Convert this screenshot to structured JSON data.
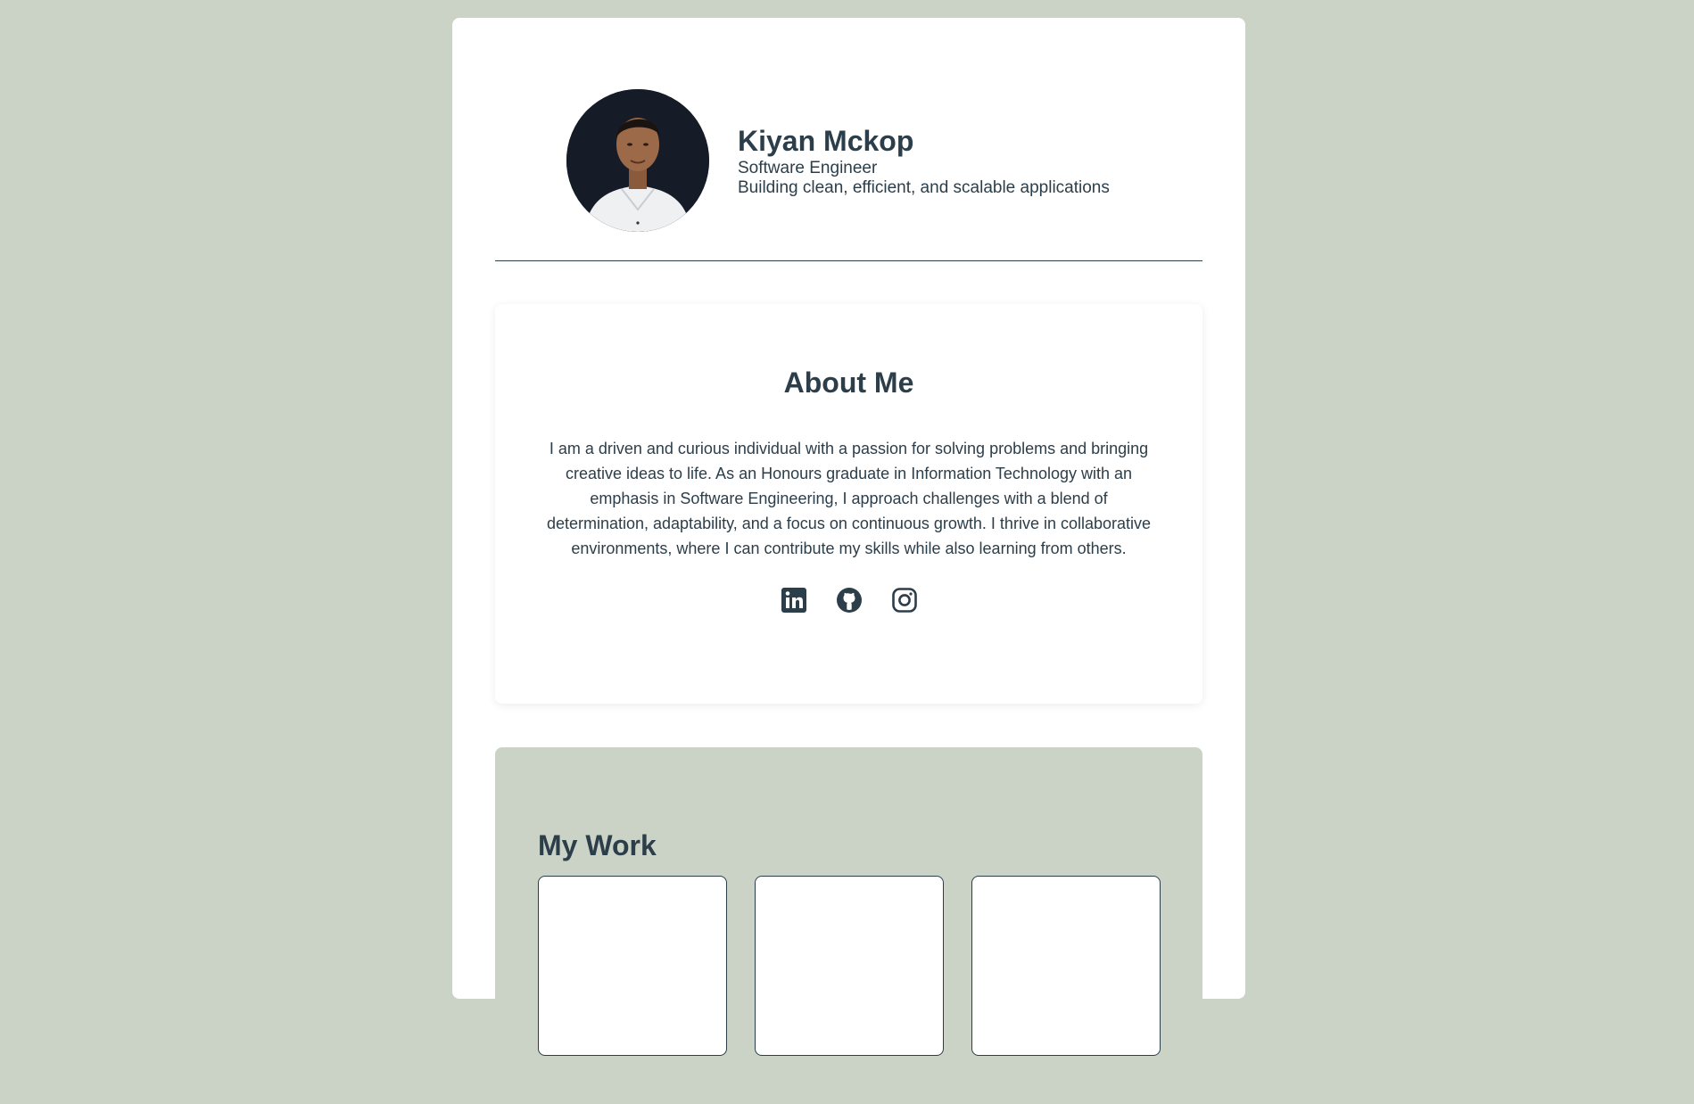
{
  "profile": {
    "name": "Kiyan Mckop",
    "role": "Software Engineer",
    "tagline": "Building clean, efficient, and scalable applications",
    "avatar_icon": "profile-photo"
  },
  "about": {
    "title": "About Me",
    "text": "I am a driven and curious individual with a passion for solving problems and bringing creative ideas to life. As an Honours graduate in Information Technology with an emphasis in Software Engineering, I approach challenges with a blend of determination, adaptability, and a focus on continuous growth. I thrive in collaborative environments, where I can contribute my skills while also learning from others.",
    "socials": [
      {
        "icon": "linkedin-icon"
      },
      {
        "icon": "github-icon"
      },
      {
        "icon": "instagram-icon"
      }
    ]
  },
  "work": {
    "title": "My Work"
  },
  "colors": {
    "background": "#cbd3c7",
    "text": "#2c3e4a",
    "card": "#ffffff"
  }
}
